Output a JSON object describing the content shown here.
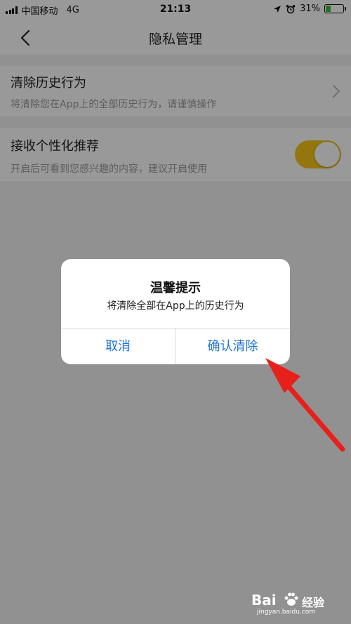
{
  "status_bar": {
    "carrier": "中国移动",
    "network": "4G",
    "time": "21:13",
    "battery_percent": "31%",
    "battery_level": 0.31,
    "battery_color": "#3dc23d"
  },
  "nav": {
    "title": "隐私管理",
    "back_icon": "chevron-left-icon"
  },
  "settings": {
    "clear_history": {
      "title": "清除历史行为",
      "desc": "将清除您在App上的全部历史行为，请谨慎操作",
      "icon": "chevron-right-icon"
    },
    "personalized": {
      "title": "接收个性化推荐",
      "desc": "开启后可看到您感兴趣的内容，建议开启使用",
      "enabled": true,
      "toggle_color": "#f5c518"
    }
  },
  "dialog": {
    "title": "温馨提示",
    "message": "将清除全部在App上的历史行为",
    "cancel_label": "取消",
    "confirm_label": "确认清除",
    "button_color": "#1f74d6"
  },
  "annotation": {
    "arrow_color": "#e8201c"
  },
  "watermark": {
    "logo": "Bai",
    "logo_suffix": "经验",
    "url": "jingyan.baidu.com"
  }
}
